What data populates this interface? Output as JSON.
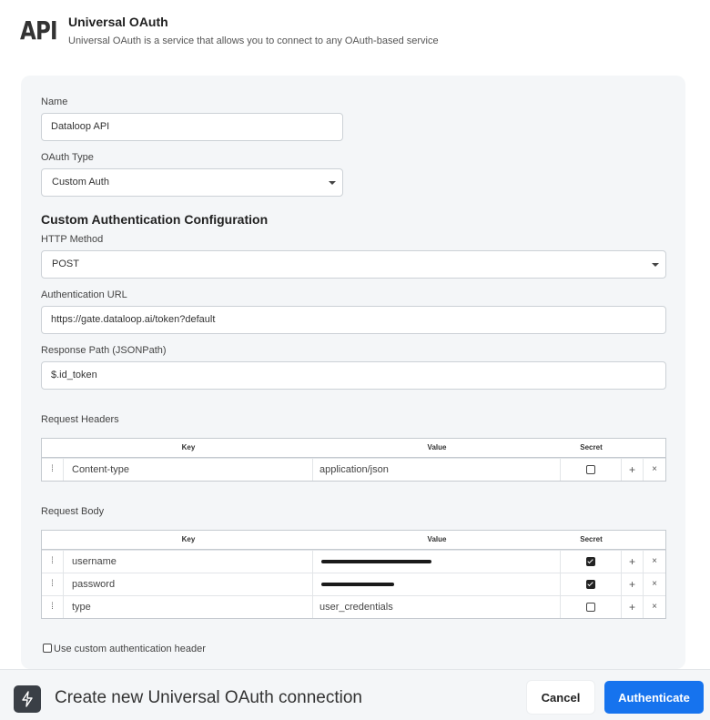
{
  "header": {
    "logo_text": "API",
    "title": "Universal OAuth",
    "description": "Universal OAuth is a service that allows you to connect to any OAuth-based service"
  },
  "form": {
    "name_label": "Name",
    "name_value": "Dataloop API",
    "oauth_type_label": "OAuth Type",
    "oauth_type_value": "Custom Auth",
    "section_title": "Custom Authentication Configuration",
    "http_method_label": "HTTP Method",
    "http_method_value": "POST",
    "auth_url_label": "Authentication URL",
    "auth_url_value": "https://gate.dataloop.ai/token?default",
    "response_path_label": "Response Path (JSONPath)",
    "response_path_value": "$.id_token",
    "request_headers_label": "Request Headers",
    "request_body_label": "Request Body",
    "custom_header_checkbox_label": "Use custom authentication header"
  },
  "table_headers": {
    "key": "Key",
    "value": "Value",
    "secret": "Secret"
  },
  "request_headers": [
    {
      "key": "Content-type",
      "value": "application/json",
      "secret": false,
      "redacted": false
    }
  ],
  "request_body": [
    {
      "key": "username",
      "value": "",
      "secret": true,
      "redacted": true
    },
    {
      "key": "password",
      "value": "",
      "secret": true,
      "redacted": true
    },
    {
      "key": "type",
      "value": "user_credentials",
      "secret": false,
      "redacted": false
    }
  ],
  "row_controls": {
    "drag": "⁞",
    "add": "+",
    "remove": "×"
  },
  "footer": {
    "title": "Create new Universal OAuth connection",
    "cancel_label": "Cancel",
    "authenticate_label": "Authenticate"
  },
  "colors": {
    "primary": "#1673ee",
    "panel_bg": "#f4f6f8",
    "icon_bg": "#3a3f46"
  },
  "icons": {
    "footer_icon": "lightning-bolt-icon"
  }
}
